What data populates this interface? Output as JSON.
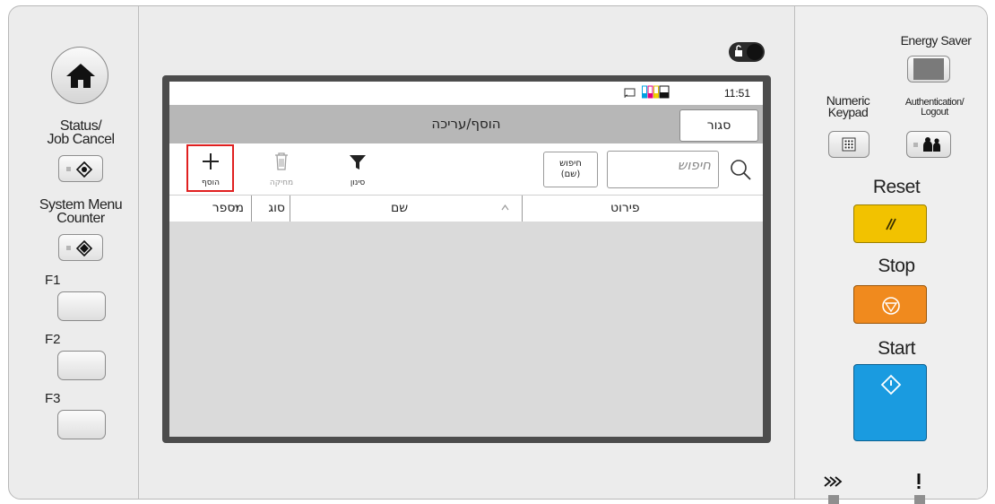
{
  "left_panel": {
    "home_icon": "home-icon",
    "status_label": "Status/\nJob Cancel",
    "system_menu_label": "System Menu\nCounter",
    "f1_label": "F1",
    "f2_label": "F2",
    "f3_label": "F3"
  },
  "screen": {
    "status_bar": {
      "time": "11:51",
      "icons": [
        "screen-mirror-icon",
        "toner-level-icon"
      ]
    },
    "title_bar": {
      "title": "הוסף/עריכה",
      "close_label": "סגור"
    },
    "toolbar": {
      "add_label": "הוסף",
      "delete_label": "מחיקה",
      "filter_label": "סינון",
      "search_by_line1": "חיפוש",
      "search_by_line2": "(שם)",
      "search_placeholder": "חיפוש"
    },
    "table": {
      "columns": [
        {
          "label": "מספר",
          "sortable": true
        },
        {
          "label": "סוג",
          "sortable": false
        },
        {
          "label": "שם",
          "sortable": true
        },
        {
          "label": "פירוט",
          "sortable": false
        }
      ],
      "rows": []
    }
  },
  "right_panel": {
    "energy_saver_label": "Energy Saver",
    "numeric_keypad_label": "Numeric\nKeypad",
    "authentication_label": "Authentication/\nLogout",
    "reset_label": "Reset",
    "stop_label": "Stop",
    "start_label": "Start",
    "colors": {
      "reset": "#f2c200",
      "stop": "#f08a1e",
      "start": "#1a9be0"
    }
  }
}
